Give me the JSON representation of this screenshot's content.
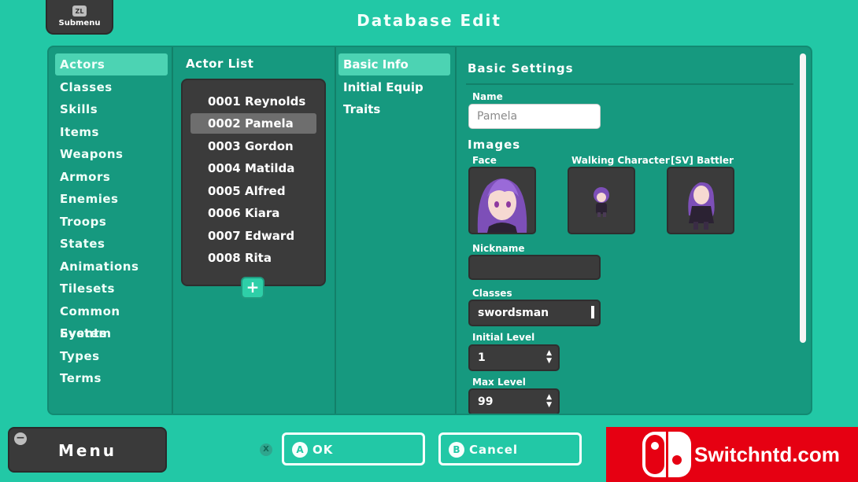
{
  "header": {
    "submenu_badge": "ZL",
    "submenu_label": "Submenu",
    "title": "Database Edit"
  },
  "categories": [
    "Actors",
    "Classes",
    "Skills",
    "Items",
    "Weapons",
    "Armors",
    "Enemies",
    "Troops",
    "States",
    "Animations",
    "Tilesets",
    "Common Events",
    "System",
    "Types",
    "Terms"
  ],
  "selected_category": "Actors",
  "actor_list": {
    "title": "Actor List",
    "items": [
      "0001 Reynolds",
      "0002 Pamela",
      "0003 Gordon",
      "0004 Matilda",
      "0005 Alfred",
      "0006 Kiara",
      "0007 Edward",
      "0008 Rita"
    ],
    "selected": "0002 Pamela",
    "add_label": "+"
  },
  "tabs": [
    "Basic Info",
    "Initial Equip",
    "Traits"
  ],
  "selected_tab": "Basic Info",
  "basic_settings": {
    "title": "Basic Settings",
    "name_label": "Name",
    "name_value": "Pamela",
    "images_title": "Images",
    "face_label": "Face",
    "walking_label": "Walking Character",
    "battler_label": "[SV] Battler",
    "nickname_label": "Nickname",
    "nickname_value": "",
    "classes_label": "Classes",
    "classes_value": "swordsman",
    "initial_level_label": "Initial Level",
    "initial_level_value": "1",
    "max_level_label": "Max Level",
    "max_level_value": "99"
  },
  "footer": {
    "menu_badge": "−",
    "menu_label": "Menu",
    "x_badge": "X",
    "ok_letter": "A",
    "ok_label": "OK",
    "cancel_letter": "B",
    "cancel_label": "Cancel"
  },
  "watermark": {
    "text": "Switchntd.com"
  },
  "colors": {
    "background": "#22c8a6",
    "panel": "#16997f",
    "selected": "#4cd3b3",
    "dark_box": "#3b3b3b",
    "watermark_red": "#e60012"
  }
}
